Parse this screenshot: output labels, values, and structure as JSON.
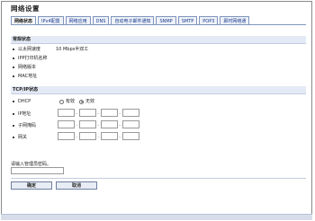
{
  "page": {
    "title": "网络设置"
  },
  "tabs": [
    {
      "label": "网络状态",
      "active": true
    },
    {
      "label": "IPv4配置",
      "active": false
    },
    {
      "label": "网络应用",
      "active": false
    },
    {
      "label": "DNS",
      "active": false
    },
    {
      "label": "自动电子邮件通知",
      "active": false
    },
    {
      "label": "SNMP",
      "active": false
    },
    {
      "label": "SMTP",
      "active": false
    },
    {
      "label": "POP3",
      "active": false
    },
    {
      "label": "即时网络通",
      "active": false
    }
  ],
  "network_status": {
    "header": "常规状态",
    "rows": [
      {
        "label": "以太网速度",
        "value": "10 Mbps半双工"
      },
      {
        "label": "IPP打印机名称",
        "value": ""
      },
      {
        "label": "网络版本",
        "value": ""
      },
      {
        "label": "MAC地址",
        "value": ""
      }
    ]
  },
  "tcpip": {
    "header": "TCP/IP状态",
    "dhcp": {
      "label": "DHCP",
      "option_on": "有效",
      "option_off": "无效",
      "selected": "off"
    },
    "ip_address": {
      "label": "IP地址"
    },
    "subnet_mask": {
      "label": "子网掩码"
    },
    "gateway": {
      "label": "网关"
    }
  },
  "password": {
    "label": "请输入管理员密码。",
    "value": ""
  },
  "buttons": {
    "ok": "确定",
    "cancel": "取消"
  },
  "colors": {
    "tab_border": "#7f94bb",
    "section_bg": "#e4eaf5",
    "bottom_bar": "#d7deea"
  }
}
